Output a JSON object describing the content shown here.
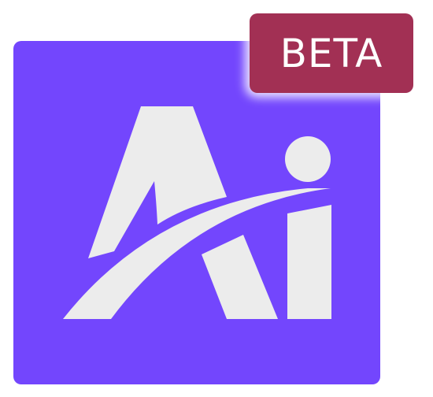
{
  "logo": {
    "tile_color": "#7346fd",
    "glyph_color": "#ececec",
    "icon": "ai-logo-icon"
  },
  "badge": {
    "label": "BETA",
    "background": "#a23054",
    "text_color": "#ffffff"
  }
}
